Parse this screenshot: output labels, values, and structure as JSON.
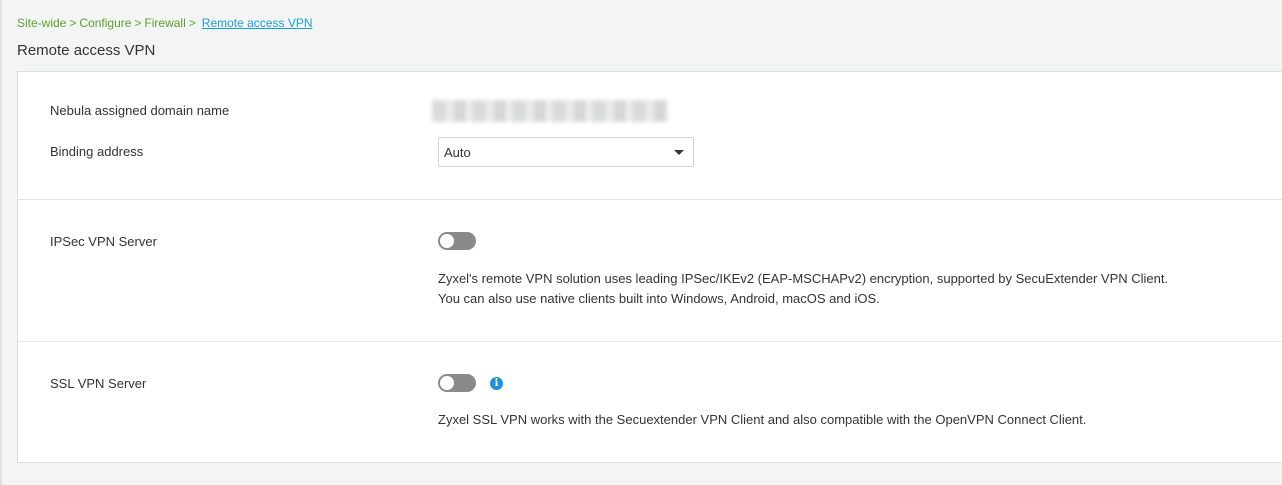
{
  "breadcrumb": {
    "items": [
      "Site-wide",
      "Configure",
      "Firewall"
    ],
    "separator": ">",
    "current": "Remote access VPN"
  },
  "page_title": "Remote access VPN",
  "general": {
    "domain_label": "Nebula assigned domain name",
    "domain_value": "",
    "binding_label": "Binding address",
    "binding_value": "Auto"
  },
  "ipsec": {
    "label": "IPSec VPN Server",
    "enabled": false,
    "desc_line1": "Zyxel's remote VPN solution uses leading IPSec/IKEv2 (EAP-MSCHAPv2) encryption, supported by SecuExtender VPN Client.",
    "desc_line2": "You can also use native clients built into Windows, Android, macOS and iOS."
  },
  "ssl": {
    "label": "SSL VPN Server",
    "enabled": false,
    "info_icon": "i",
    "desc": "Zyxel SSL VPN works with the Secuextender VPN Client and also compatible with the OpenVPN Connect Client."
  },
  "colors": {
    "breadcrumb": "#5aa02c",
    "link": "#1b9fd8",
    "toggle_off": "#8a8a8a",
    "info": "#1b8fe0"
  }
}
